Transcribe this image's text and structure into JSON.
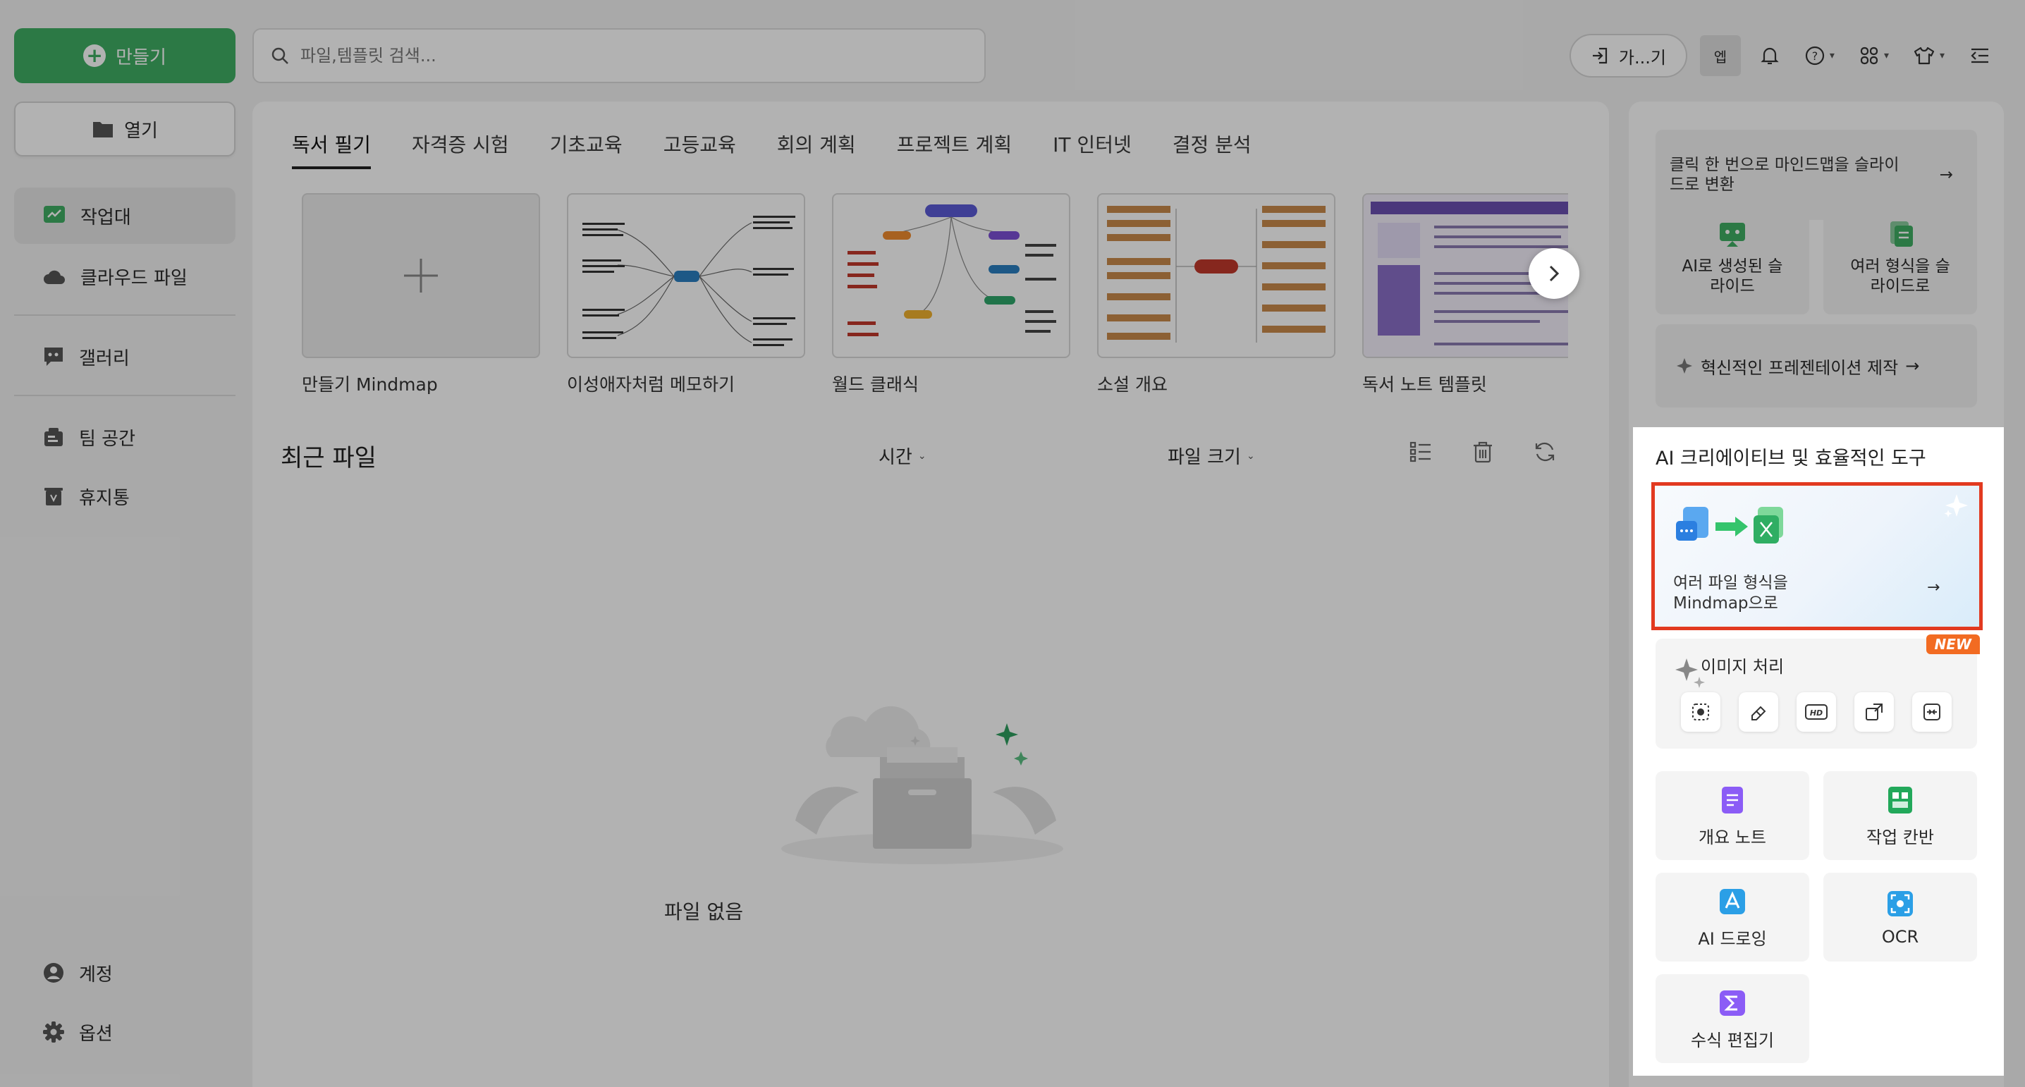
{
  "topbar": {
    "create_label": "만들기",
    "search_placeholder": "파일,템플릿 검색...",
    "join_label": "가...기",
    "avatar_text": "엡"
  },
  "sidebar": {
    "open_label": "열기",
    "items": [
      {
        "label": "작업대",
        "icon": "workbench-icon",
        "active": true
      },
      {
        "label": "클라우드 파일",
        "icon": "cloud-icon",
        "active": false
      },
      {
        "label": "갤러리",
        "icon": "gallery-icon",
        "active": false
      },
      {
        "label": "팀 공간",
        "icon": "team-icon",
        "active": false
      },
      {
        "label": "휴지통",
        "icon": "trash-icon",
        "active": false
      }
    ],
    "bottom": [
      {
        "label": "계정",
        "icon": "account-icon"
      },
      {
        "label": "옵션",
        "icon": "gear-icon"
      }
    ]
  },
  "main": {
    "tabs": [
      "독서 필기",
      "자격증 시험",
      "기초교육",
      "고등교육",
      "회의 계획",
      "프로젝트 계획",
      "IT 인터넷",
      "결정 분석"
    ],
    "templates": [
      {
        "name": "만들기 Mindmap"
      },
      {
        "name": "이성애자처럼 메모하기"
      },
      {
        "name": "월드 클래식"
      },
      {
        "name": "소설 개요"
      },
      {
        "name": "독서 노트 템플릿"
      }
    ],
    "recent_title": "최근 파일",
    "sort_time": "시간",
    "sort_size": "파일 크기",
    "empty_label": "파일 없음"
  },
  "right": {
    "slide_convert": "클릭 한 번으로 마인드맵을 슬라이드로 변환",
    "ai_slides": "AI로 생성된 슬라이드",
    "multi_slides": "여러 형식을 슬라이드로",
    "presentation": "혁신적인 프레젠테이션 제작",
    "ai_section_title": "AI 크리에이티브 및 효율적인 도구",
    "highlight_card": "여러 파일 형식을 Mindmap으로",
    "image_title": "이미지 처리",
    "new_badge": "NEW",
    "hd_label": "HD",
    "tools": [
      {
        "label": "개요 노트",
        "icon": "outline-note-icon",
        "color": "#8b5cf6"
      },
      {
        "label": "작업 칸반",
        "icon": "kanban-icon",
        "color": "#22a85a"
      },
      {
        "label": "AI 드로잉",
        "icon": "ai-drawing-icon",
        "color": "#2b9fe6"
      },
      {
        "label": "OCR",
        "icon": "ocr-icon",
        "color": "#2b9fe6"
      },
      {
        "label": "수식 편집기",
        "icon": "formula-icon",
        "color": "#8b5cf6"
      }
    ]
  },
  "colors": {
    "accent": "#3fae63",
    "highlight_border": "#e23a20",
    "badge": "#f26b22"
  }
}
